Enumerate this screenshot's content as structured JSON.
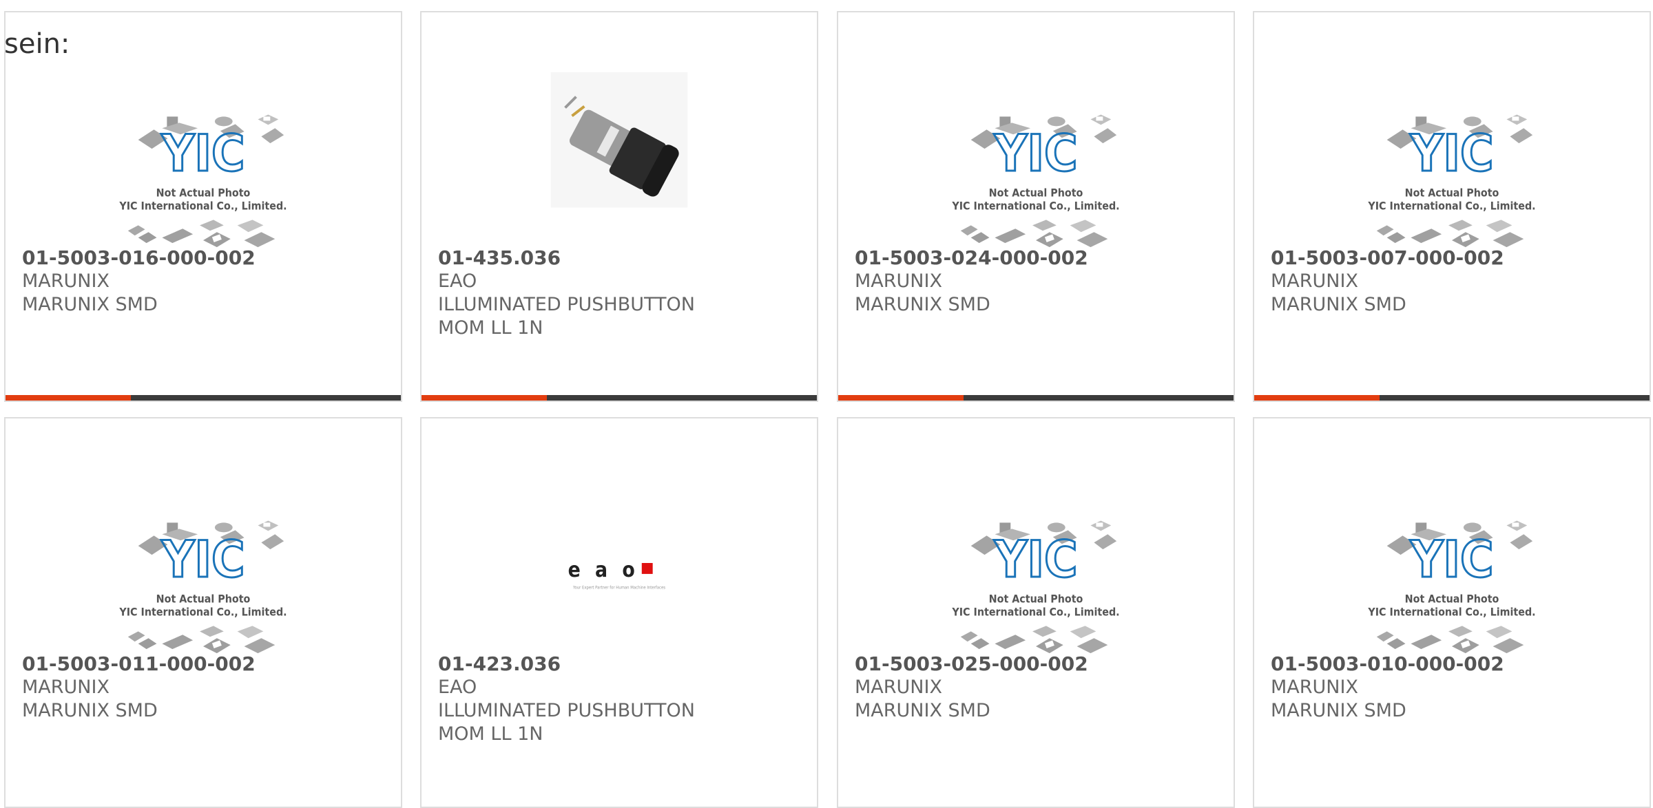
{
  "lead_text": "sein:",
  "placeholder": {
    "line1": "Not Actual Photo",
    "line2": "YIC International Co., Limited."
  },
  "eao_logo": {
    "wordmark": "e a o",
    "tagline": "Your Expert Partner for Human Machine Interfaces"
  },
  "colors": {
    "accent": "#e23d10",
    "bar": "#3b3b3b",
    "logo_blue": "#1a73b8"
  },
  "products": [
    {
      "part_number": "01-5003-016-000-002",
      "manufacturer": "MARUNIX",
      "desc1": "MARUNIX SMD",
      "desc2": "",
      "image": "yic-placeholder"
    },
    {
      "part_number": "01-435.036",
      "manufacturer": "EAO",
      "desc1": "ILLUMINATED PUSHBUTTON",
      "desc2": "MOM LL 1N",
      "image": "pushbutton-photo"
    },
    {
      "part_number": "01-5003-024-000-002",
      "manufacturer": "MARUNIX",
      "desc1": "MARUNIX SMD",
      "desc2": "",
      "image": "yic-placeholder"
    },
    {
      "part_number": "01-5003-007-000-002",
      "manufacturer": "MARUNIX",
      "desc1": "MARUNIX SMD",
      "desc2": "",
      "image": "yic-placeholder"
    },
    {
      "part_number": "01-5003-011-000-002",
      "manufacturer": "MARUNIX",
      "desc1": "MARUNIX SMD",
      "desc2": "",
      "image": "yic-placeholder"
    },
    {
      "part_number": "01-423.036",
      "manufacturer": "EAO",
      "desc1": "ILLUMINATED PUSHBUTTON",
      "desc2": "MOM LL 1N",
      "image": "eao-logo"
    },
    {
      "part_number": "01-5003-025-000-002",
      "manufacturer": "MARUNIX",
      "desc1": "MARUNIX SMD",
      "desc2": "",
      "image": "yic-placeholder"
    },
    {
      "part_number": "01-5003-010-000-002",
      "manufacturer": "MARUNIX",
      "desc1": "MARUNIX SMD",
      "desc2": "",
      "image": "yic-placeholder"
    }
  ]
}
